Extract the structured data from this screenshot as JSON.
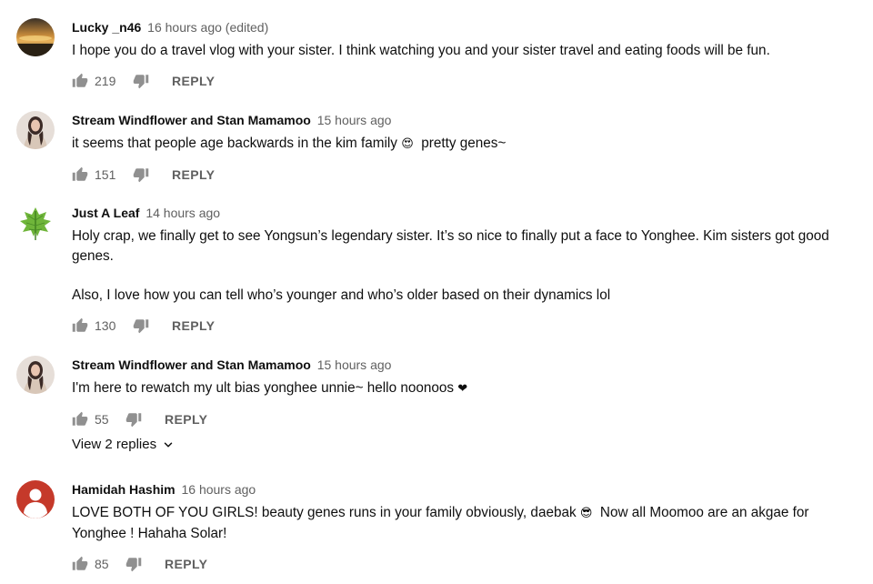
{
  "comments": [
    {
      "author": "Lucky _n46",
      "time": "16 hours ago (edited)",
      "paragraphs": [
        "I hope you do a travel vlog with your sister. I think watching you and your sister travel and eating foods will be fun."
      ],
      "likes": "219",
      "reply_label": "REPLY",
      "avatar": "sunset-photo"
    },
    {
      "author": "Stream Windflower and Stan Mamamoo",
      "time": "15 hours ago",
      "text_before": "it seems that people age backwards in the kim family ",
      "emoji": "😍",
      "text_after": "  pretty genes~",
      "likes": "151",
      "reply_label": "REPLY",
      "avatar": "woman-photo"
    },
    {
      "author": "Just A Leaf",
      "time": "14 hours ago",
      "paragraphs": [
        "Holy crap, we finally get to see Yongsun’s legendary sister. It’s so nice to finally put a face to Yonghee. Kim sisters got good genes.",
        "Also, I love how you can tell who’s younger and who’s older based on their dynamics lol"
      ],
      "likes": "130",
      "reply_label": "REPLY",
      "avatar": "green-leaf"
    },
    {
      "author": "Stream Windflower and Stan Mamamoo",
      "time": "15 hours ago",
      "text_before": "I'm here to rewatch my ult bias yonghee unnie~ hello noonoos ",
      "emoji": "❤",
      "text_after": "",
      "likes": "55",
      "reply_label": "REPLY",
      "view_replies": "View 2 replies",
      "avatar": "woman-photo"
    },
    {
      "author": "Hamidah Hashim",
      "time": "16 hours ago",
      "text_before": "LOVE BOTH OF YOU GIRLS! beauty genes runs in your family obviously, daebak ",
      "emoji": "😎",
      "text_after": "  Now all Moomoo are an akgae for Yonghee ! Hahaha Solar!",
      "likes": "85",
      "reply_label": "REPLY",
      "avatar": "default-user"
    }
  ],
  "colors": {
    "text": "#0f0f0f",
    "secondary": "#606060",
    "icon": "#909090",
    "default_avatar": "#c5392a"
  },
  "icons": [
    "thumb-up-icon",
    "thumb-down-icon",
    "chevron-down-icon"
  ]
}
